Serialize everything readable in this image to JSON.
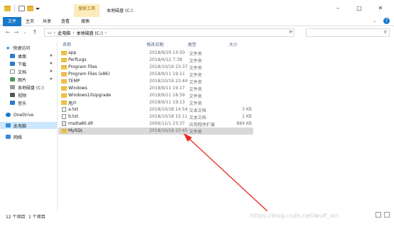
{
  "titlebar": {
    "context_tab": "搜索工具",
    "title": "本地磁盘 (C:)"
  },
  "ribbon": {
    "tabs": [
      "文件",
      "主页",
      "共享",
      "查看",
      "搜索"
    ]
  },
  "address": {
    "crumbs": [
      "此电脑",
      "本地磁盘 (C:)"
    ]
  },
  "sidebar": {
    "items": [
      {
        "label": "快速访问",
        "pinned": false
      },
      {
        "label": "桌面",
        "pinned": true
      },
      {
        "label": "下载",
        "pinned": true
      },
      {
        "label": "文档",
        "pinned": true
      },
      {
        "label": "图片",
        "pinned": true
      },
      {
        "label": "本地磁盘 (C:)",
        "pinned": false
      },
      {
        "label": "视频",
        "pinned": false
      },
      {
        "label": "音乐",
        "pinned": false
      },
      {
        "label": "OneDrive",
        "pinned": false
      },
      {
        "label": "此电脑",
        "pinned": false
      },
      {
        "label": "网络",
        "pinned": false
      }
    ]
  },
  "columns": {
    "name": "名称",
    "date": "修改日期",
    "type": "类型",
    "size": "大小"
  },
  "files": [
    {
      "name": "app",
      "date": "2018/9/29 14:50",
      "type": "文件夹",
      "size": "",
      "kind": "folder"
    },
    {
      "name": "PerfLogs",
      "date": "2018/4/12 7:38",
      "type": "文件夹",
      "size": "",
      "kind": "folder"
    },
    {
      "name": "Program Files",
      "date": "2018/10/19 23:37",
      "type": "文件夹",
      "size": "",
      "kind": "folder"
    },
    {
      "name": "Program Files (x86)",
      "date": "2018/9/11 19:11",
      "type": "文件夹",
      "size": "",
      "kind": "folder"
    },
    {
      "name": "TEMP",
      "date": "2018/10/19 23:44",
      "type": "文件夹",
      "size": "",
      "kind": "folder"
    },
    {
      "name": "Windows",
      "date": "2018/9/11 19:17",
      "type": "文件夹",
      "size": "",
      "kind": "folder"
    },
    {
      "name": "Windows10Upgrade",
      "date": "2018/9/11 18:59",
      "type": "文件夹",
      "size": "",
      "kind": "folder"
    },
    {
      "name": "用户",
      "date": "2018/9/11 19:13",
      "type": "文件夹",
      "size": "",
      "kind": "folder"
    },
    {
      "name": "a.txt",
      "date": "2018/10/18 14:54",
      "type": "文本文档",
      "size": "3 KB",
      "kind": "file"
    },
    {
      "name": "b.txt",
      "date": "2018/10/18 15:11",
      "type": "文本文档",
      "size": "1 KB",
      "kind": "file"
    },
    {
      "name": "msdia80.dll",
      "date": "2006/12/1 23:37",
      "type": "应用程序扩展",
      "size": "884 KB",
      "kind": "dll"
    },
    {
      "name": "MySQL",
      "date": "2018/10/19 23:45",
      "type": "文件夹",
      "size": "",
      "kind": "folder",
      "selected": true
    }
  ],
  "status": {
    "count": "12 个项目",
    "selected": "1 个项目"
  },
  "watermark": "https://blog.csdn.net/wulf_xin",
  "colors": {
    "accent": "#1979ca",
    "context_tab_bg": "#fcecbd",
    "selection": "#cce8ff",
    "arrow": "#e8281e"
  }
}
